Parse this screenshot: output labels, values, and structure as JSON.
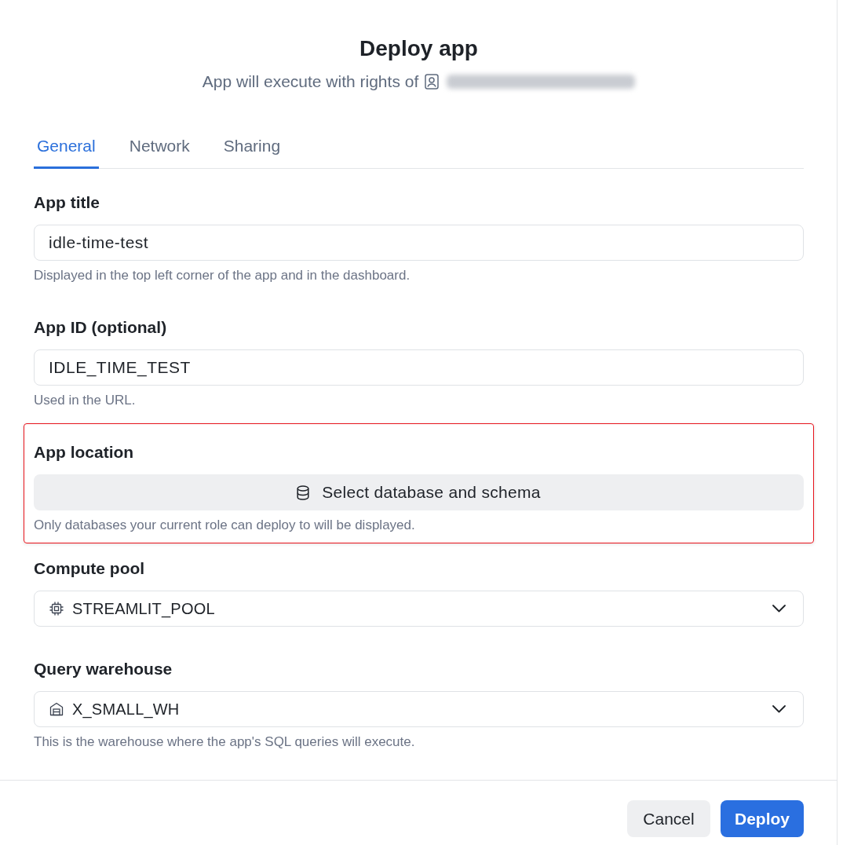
{
  "dialog": {
    "title": "Deploy app",
    "subtitle": "App will execute with rights of"
  },
  "tabs": [
    {
      "label": "General",
      "selected": true
    },
    {
      "label": "Network",
      "selected": false
    },
    {
      "label": "Sharing",
      "selected": false
    }
  ],
  "fields": [
    {
      "kind": "text",
      "label": "App title",
      "value": "idle-time-test",
      "help": "Displayed in the top left corner of the app and in the dashboard.",
      "highlighted": false
    },
    {
      "kind": "text",
      "label": "App ID (optional)",
      "value": "IDLE_TIME_TEST",
      "help": "Used in the URL.",
      "highlighted": false
    },
    {
      "kind": "picker",
      "label": "App location",
      "button": "Select database and schema",
      "help": "Only databases your current role can deploy to will be displayed.",
      "highlighted": true
    },
    {
      "kind": "select",
      "label": "Compute pool",
      "value": "STREAMLIT_POOL",
      "highlighted": false
    },
    {
      "kind": "select",
      "label": "Query warehouse",
      "value": "X_SMALL_WH",
      "help": "This is the warehouse where the app's SQL queries will execute.",
      "highlighted": false
    }
  ],
  "buttons": [
    {
      "label": "Cancel",
      "kind": "secondary"
    },
    {
      "label": "Deploy",
      "kind": "primary"
    }
  ]
}
